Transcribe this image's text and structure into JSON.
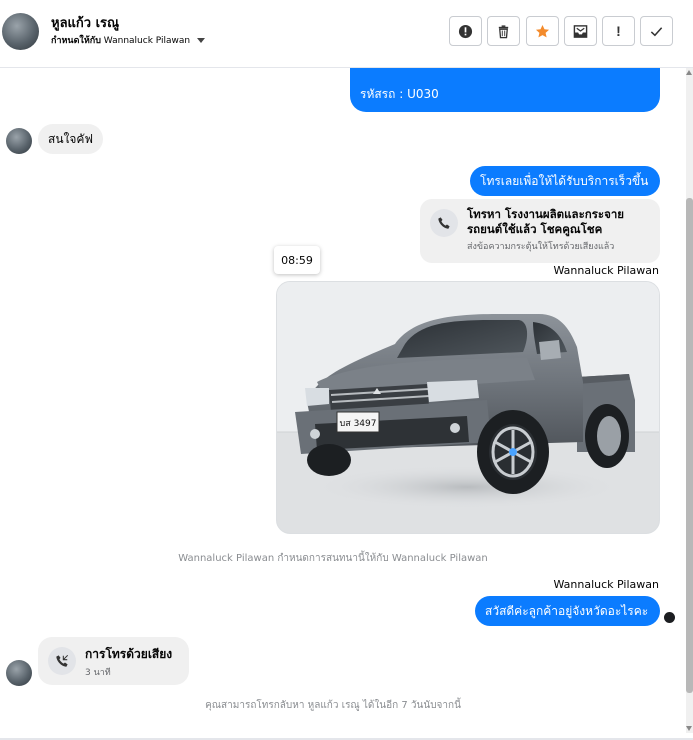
{
  "header": {
    "contact_name": "หูลแก้ว เรณู",
    "assign_label": "กำหนดให้กับ",
    "assignee": "Wannaluck Pilawan"
  },
  "toolbar": {
    "buttons": [
      {
        "name": "mark-spam",
        "icon": "alert-circle-icon"
      },
      {
        "name": "delete",
        "icon": "trash-icon"
      },
      {
        "name": "star",
        "icon": "star-icon",
        "color": "#f38b2c"
      },
      {
        "name": "mark-unread",
        "icon": "envelope-icon"
      },
      {
        "name": "follow-up",
        "icon": "exclamation-icon",
        "label": "!"
      },
      {
        "name": "mark-done",
        "icon": "check-icon"
      }
    ]
  },
  "messages": {
    "car_code_text": "รหัสรถ : U030",
    "customer_reply": "สนใจคัฟ",
    "call_prompt": "โทรเลยเพื่อให้ได้รับบริการเร็วขึ้น",
    "call_card": {
      "title": "โทรหา โรงงานผลิตและกระจายรถยนต์ใช้แล้ว โชคคูณโชค",
      "subtitle": "ส่งข้อความกระตุ้นให้โทรด้วยเสียงแล้ว"
    },
    "timestamp": "08:59",
    "sender_name_1": "Wannaluck Pilawan",
    "system_assign": "Wannaluck Pilawan กำหนดการสนทนานี้ให้กับ Wannaluck Pilawan",
    "sender_name_2": "Wannaluck Pilawan",
    "greeting": "สวัสดีค่ะลูกค้าอยู่จังหวัดอะไรคะ",
    "voice_call": {
      "title": "การโทรด้วยเสียง",
      "duration": "3 นาที"
    },
    "callback_notice": "คุณสามารถโทรกลับหา หูลแก้ว เรณู ได้ในอีก 7 วันนับจากนี้",
    "plate": "บส 3497"
  },
  "colors": {
    "accent": "#0b7cff",
    "bubble_in": "#f0f0f0",
    "star": "#f38b2c"
  }
}
